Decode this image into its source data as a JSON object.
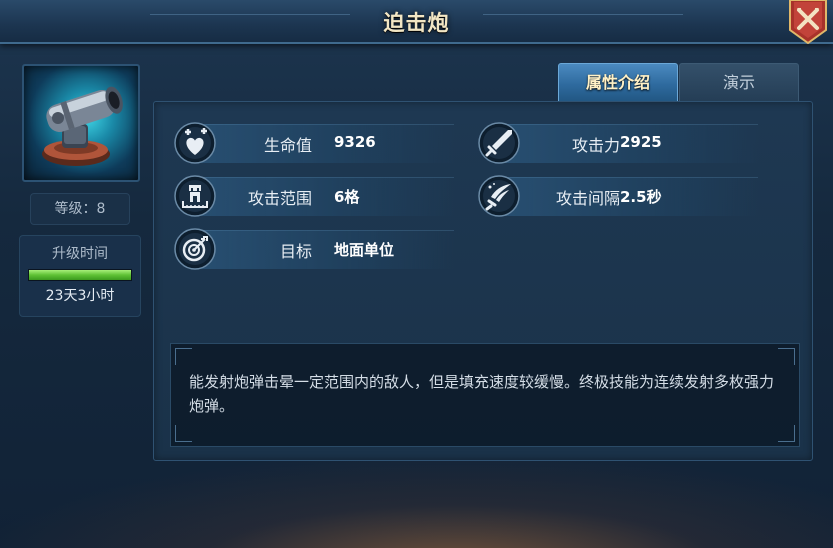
{
  "window": {
    "title": "迫击炮"
  },
  "unit": {
    "level_label": "等级：8",
    "upgrade_label": "升级时间",
    "upgrade_progress": 1.0,
    "upgrade_time": "23天3小时"
  },
  "tabs": [
    {
      "label": "属性介绍",
      "active": true
    },
    {
      "label": "演示",
      "active": false
    }
  ],
  "stats": {
    "hp": {
      "label": "生命值",
      "value": "9326",
      "icon": "heart-plus-icon"
    },
    "attack": {
      "label": "攻击力",
      "value": "2925",
      "icon": "sword-icon"
    },
    "range": {
      "label": "攻击范围",
      "value": "6格",
      "icon": "fortress-range-icon"
    },
    "interval": {
      "label": "攻击间隔",
      "value": "2.5秒",
      "icon": "wing-speed-icon"
    },
    "target": {
      "label": "目标",
      "value": "地面单位",
      "icon": "target-icon"
    }
  },
  "description": "能发射炮弹击晕一定范围内的敌人，但是填充速度较缓慢。终极技能为连续发射多枚强力炮弹。",
  "colors": {
    "accent": "#4b8ac0",
    "progress": "#5fc235",
    "title": "#f2e6c4"
  }
}
